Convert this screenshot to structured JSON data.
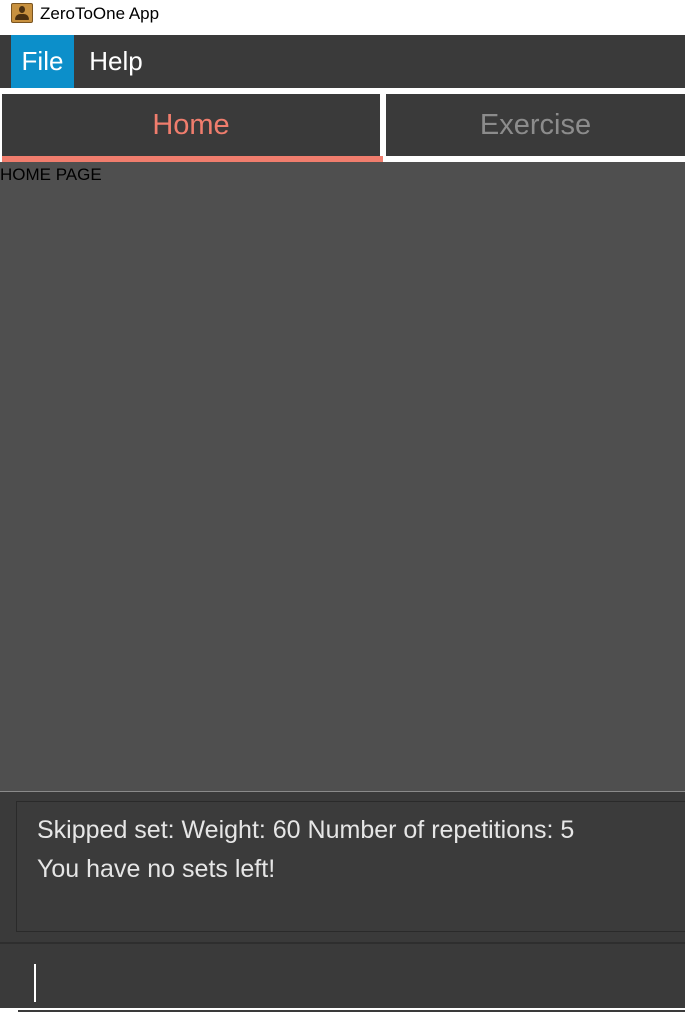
{
  "window": {
    "title": "ZeroToOne App",
    "icon": "contact-card-icon"
  },
  "menubar": {
    "items": [
      {
        "label": "File",
        "active": true
      },
      {
        "label": "Help",
        "active": false
      }
    ]
  },
  "tabs": [
    {
      "label": "Home",
      "selected": true
    },
    {
      "label": "Exercise",
      "selected": false
    }
  ],
  "content": {
    "page_label": "HOME PAGE"
  },
  "result": {
    "lines": [
      "Skipped set:  Weight: 60 Number of repetitions: 5",
      "You have no sets left!"
    ]
  },
  "command": {
    "value": "",
    "placeholder": ""
  },
  "colors": {
    "accent": "#0c8fca",
    "tab_selected": "#f07d6d",
    "panel": "#3a3a3a",
    "content_bg": "#4f4f4f"
  }
}
